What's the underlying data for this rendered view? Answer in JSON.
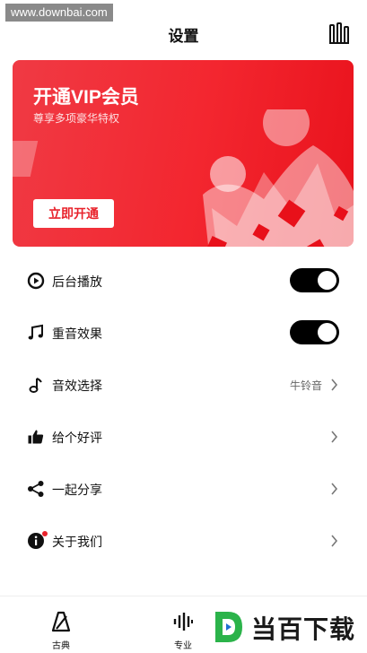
{
  "watermark": {
    "text": "www.downbai.com",
    "logo_text": "当百下载"
  },
  "header": {
    "title": "设置",
    "menu_icon": "equalizer-icon"
  },
  "vip_card": {
    "title": "开通VIP会员",
    "subtitle": "尊享多项豪华特权",
    "button_label": "立即开通",
    "accent": "#f3262f"
  },
  "settings": [
    {
      "label": "后台播放",
      "icon": "play-circle-icon",
      "control": "toggle",
      "on": true
    },
    {
      "label": "重音效果",
      "icon": "music-notes-icon",
      "control": "toggle",
      "on": true
    },
    {
      "label": "音效选择",
      "icon": "music-note-icon",
      "control": "chevron",
      "value": "牛铃音"
    },
    {
      "label": "给个好评",
      "icon": "thumbs-up-icon",
      "control": "chevron"
    },
    {
      "label": "一起分享",
      "icon": "share-icon",
      "control": "chevron"
    },
    {
      "label": "关于我们",
      "icon": "info-icon",
      "control": "chevron",
      "badge": true
    }
  ],
  "tabbar": {
    "tabs": [
      {
        "label": "古典",
        "icon": "metronome-icon"
      },
      {
        "label": "专业",
        "icon": "waveform-icon"
      }
    ]
  }
}
